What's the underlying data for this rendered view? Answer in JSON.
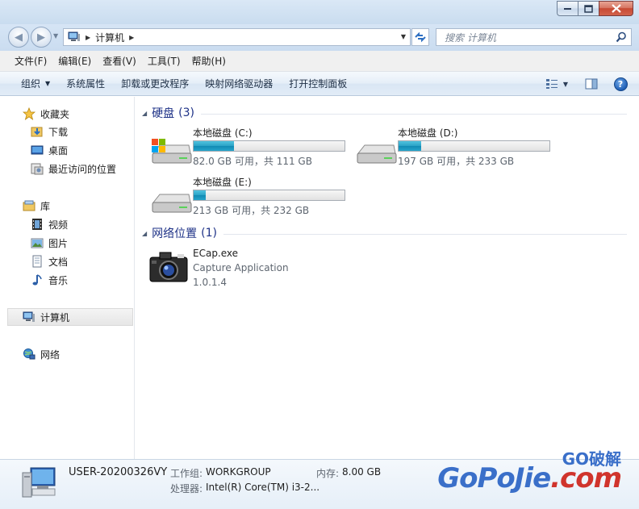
{
  "address": {
    "crumbs": [
      "计算机"
    ],
    "search_placeholder": "搜索 计算机"
  },
  "menubar": {
    "items": [
      "文件(F)",
      "编辑(E)",
      "查看(V)",
      "工具(T)",
      "帮助(H)"
    ]
  },
  "cmdbar": {
    "organize": "组织",
    "system_properties": "系统属性",
    "uninstall": "卸载或更改程序",
    "map_drive": "映射网络驱动器",
    "control_panel": "打开控制面板"
  },
  "nav": {
    "favorites": "收藏夹",
    "downloads": "下载",
    "desktop": "桌面",
    "recent": "最近访问的位置",
    "libraries": "库",
    "videos": "视频",
    "pictures": "图片",
    "documents": "文档",
    "music": "音乐",
    "computer": "计算机",
    "network": "网络"
  },
  "groups": {
    "hdd": {
      "title": "硬盘",
      "count": "(3)"
    },
    "network": {
      "title": "网络位置",
      "count": "(1)"
    }
  },
  "drives": [
    {
      "name": "本地磁盘 (C:)",
      "info": "82.0 GB 可用，共 111 GB",
      "used_fraction": 0.27,
      "system": true
    },
    {
      "name": "本地磁盘 (D:)",
      "info": "197 GB 可用，共 233 GB",
      "used_fraction": 0.15,
      "system": false
    },
    {
      "name": "本地磁盘 (E:)",
      "info": "213 GB 可用，共 232 GB",
      "used_fraction": 0.08,
      "system": false
    }
  ],
  "netloc": {
    "name": "ECap.exe",
    "desc": "Capture Application",
    "version": "1.0.1.4"
  },
  "details": {
    "hostname": "USER-20200326VY",
    "workgroup_label": "工作组:",
    "workgroup": "WORKGROUP",
    "memory_label": "内存:",
    "memory": "8.00 GB",
    "cpu_label": "处理器:",
    "cpu": "Intel(R) Core(TM) i3-2..."
  },
  "watermark": {
    "top_go": "GO",
    "top_cn": "破解",
    "main_a": "GoPoJie",
    "main_b": ".com"
  },
  "colors": {
    "accent": "#1e3287",
    "bar_fill": "#26a4cb",
    "title_bg": "#d6e5f5"
  }
}
